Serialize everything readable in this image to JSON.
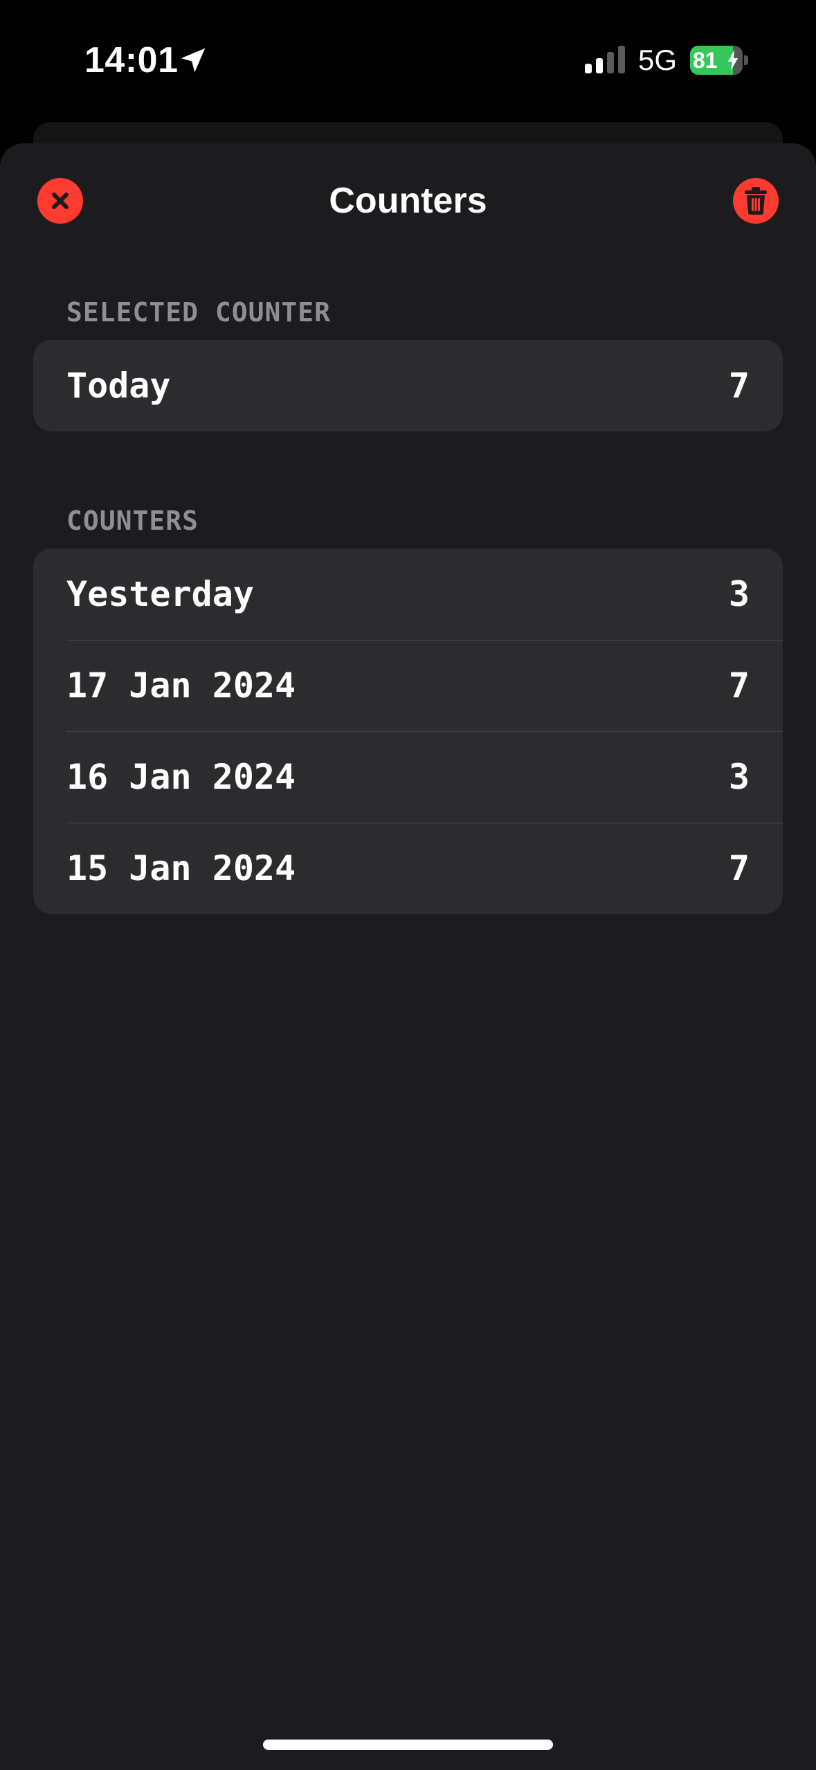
{
  "status_bar": {
    "time": "14:01",
    "network": "5G",
    "battery_level": "81",
    "battery_fraction": 0.81,
    "icons": [
      "location-arrow-icon",
      "cellular-signal-icon",
      "battery-charging-icon"
    ]
  },
  "sheet": {
    "title": "Counters",
    "close_icon": "close-icon",
    "delete_icon": "trash-icon"
  },
  "selected_section": {
    "header": "SELECTED COUNTER",
    "items": [
      {
        "label": "Today",
        "count": "7"
      }
    ]
  },
  "counters_section": {
    "header": "COUNTERS",
    "items": [
      {
        "label": "Yesterday",
        "count": "3"
      },
      {
        "label": "17 Jan 2024",
        "count": "7"
      },
      {
        "label": "16 Jan 2024",
        "count": "3"
      },
      {
        "label": "15 Jan 2024",
        "count": "7"
      }
    ]
  },
  "colors": {
    "background": "#000000",
    "sheet": "#1c1c1e",
    "group": "#2c2c2e",
    "accent_red": "#ff3b30",
    "battery_green": "#34c759",
    "secondary_text": "#8e8e93"
  }
}
